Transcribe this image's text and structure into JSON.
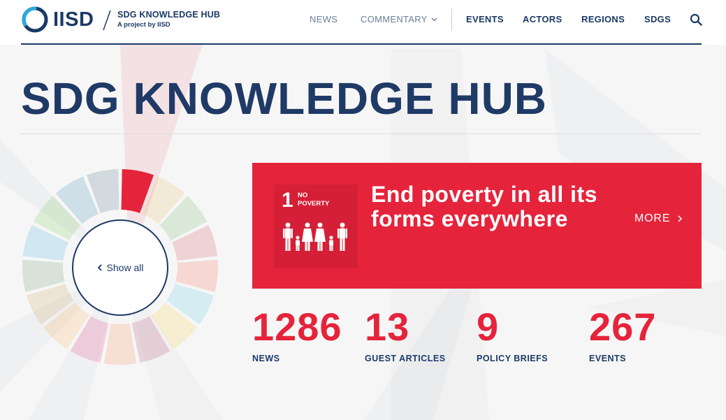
{
  "header": {
    "logo_text": "IISD",
    "hub_title": "SDG KNOWLEDGE HUB",
    "hub_subtitle": "A project by IISD",
    "nav": {
      "news": "NEWS",
      "commentary": "COMMENTARY",
      "events": "EVENTS",
      "actors": "ACTORS",
      "regions": "REGIONS",
      "sdgs": "SDGS"
    },
    "icons": [
      "chevron-down-icon",
      "search-icon"
    ]
  },
  "page_title": "SDG KNOWLEDGE HUB",
  "wheel": {
    "center_label": "Show all",
    "active_color": "#e5243b",
    "segment_colors": [
      "#e5243b",
      "#dda63a",
      "#4c9f38",
      "#c5192d",
      "#ff3a21",
      "#26bde2",
      "#fcc30b",
      "#a21942",
      "#fd6925",
      "#dd1367",
      "#fd9d24",
      "#bf8b2e",
      "#3f7e44",
      "#0a97d9",
      "#56c02b",
      "#00689d",
      "#19486a"
    ]
  },
  "goal": {
    "number": "1",
    "tile_label": "No Poverty",
    "heading": "End poverty in all its forms everywhere",
    "more_label": "MORE",
    "color": "#e5243b"
  },
  "stats": [
    {
      "value": "1286",
      "label": "NEWS"
    },
    {
      "value": "13",
      "label": "GUEST ARTICLES"
    },
    {
      "value": "9",
      "label": "POLICY BRIEFS"
    },
    {
      "value": "267",
      "label": "EVENTS"
    }
  ]
}
